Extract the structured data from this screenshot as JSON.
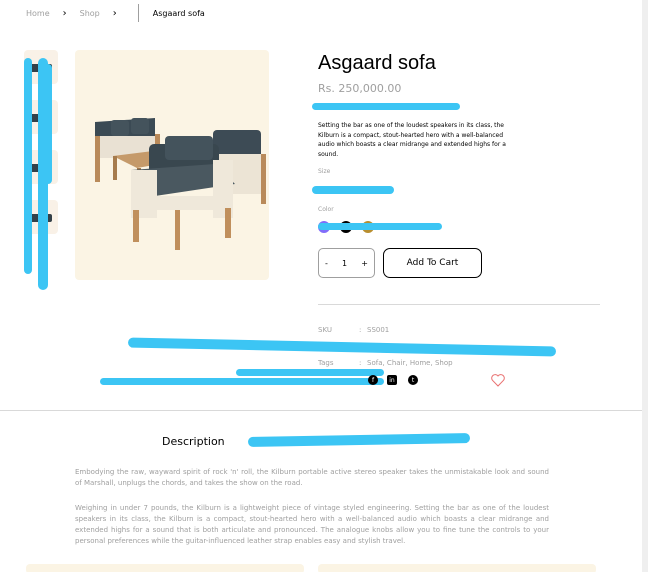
{
  "breadcrumb": {
    "home": "Home",
    "shop": "Shop",
    "current": "Asgaard sofa"
  },
  "product": {
    "title": "Asgaard sofa",
    "price": "Rs. 250,000.00",
    "description": "Setting the bar as one of the loudest speakers in its class, the Kilburn is a compact, stout-hearted hero with a well-balanced audio which boasts a clear midrange and extended highs for a sound.",
    "size_label": "Size",
    "color_label": "Color",
    "colors": [
      "#816dfa",
      "#000000",
      "#b88e2f"
    ]
  },
  "cart": {
    "minus": "-",
    "quantity": "1",
    "plus": "+",
    "add_label": "Add To Cart"
  },
  "meta": {
    "sku_label": "SKU",
    "sku_value": "SS001",
    "tags_label": "Tags",
    "tags_value": "Sofa, Chair, Home, Shop",
    "colon": ":"
  },
  "tabs": {
    "description": "Description"
  },
  "content": {
    "para1": "Embodying the raw, wayward spirit of rock 'n' roll, the Kilburn portable active stereo speaker takes the unmistakable look and sound of Marshall, unplugs the chords, and takes the show on the road.",
    "para2": "Weighing in under 7 pounds, the Kilburn is a lightweight piece of vintage styled engineering. Setting the bar as one of the loudest speakers in its class, the Kilburn is a compact, stout-hearted hero with a well-balanced audio which boasts a clear midrange and extended highs for a sound that is both articulate and pronounced. The analogue knobs allow you to fine tune the controls to your personal preferences while the guitar-influenced leather strap enables easy and stylish travel."
  },
  "icons": {
    "chevron": "chevron-right-icon",
    "linkedin": "linkedin-icon",
    "twitter": "twitter-icon",
    "facebook": "facebook-icon",
    "heart": "heart-icon"
  },
  "colors": {
    "muted_text": "#9f9f9f",
    "cream": "#f9f1e7",
    "heart": "#e97171",
    "redaction": "#3cc5f4"
  }
}
